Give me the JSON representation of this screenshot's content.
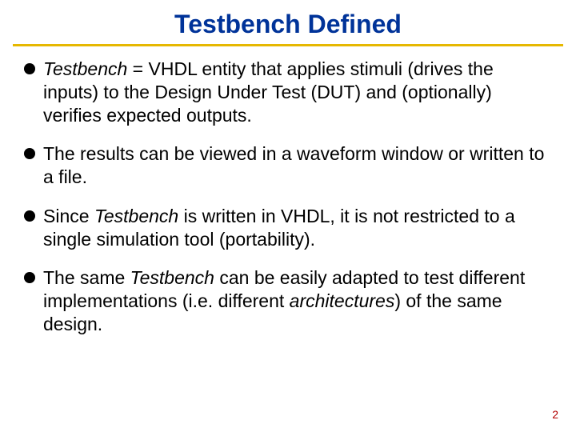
{
  "title": "Testbench Defined",
  "bullets": {
    "b0": {
      "term": "Testbench",
      "eq": " = ",
      "rest": "VHDL entity that applies stimuli (drives the inputs) to the Design Under Test (DUT) and (optionally) verifies expected outputs."
    },
    "b1": {
      "text": "The results can be viewed in a waveform window or written to a file."
    },
    "b2": {
      "pre": "Since ",
      "term": "Testbench",
      "post": " is written in VHDL, it is not restricted to a single simulation tool (portability)."
    },
    "b3": {
      "pre": "The same ",
      "term": "Testbench",
      "mid": " can be easily adapted to test different implementations (i.e. different ",
      "arch": "architectures",
      "post": ") of the same design."
    }
  },
  "page_number": "2"
}
